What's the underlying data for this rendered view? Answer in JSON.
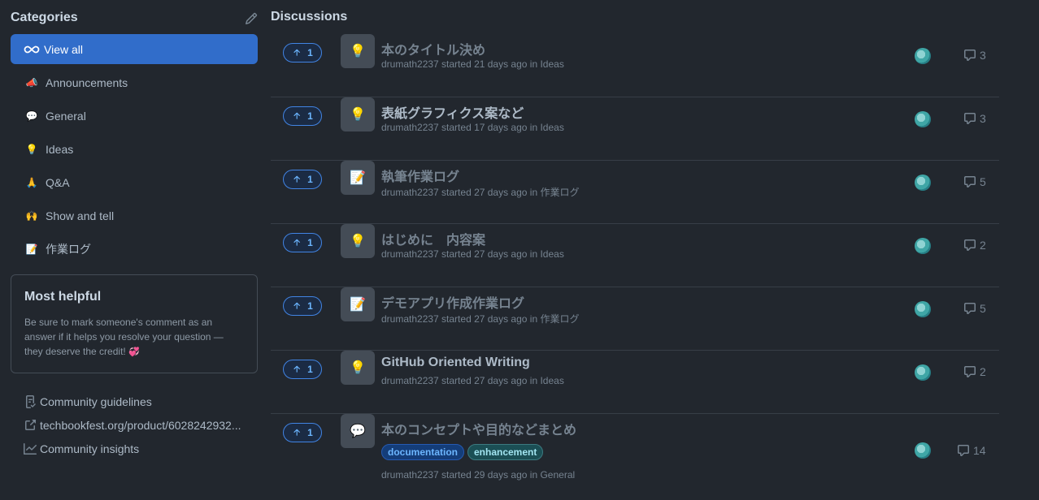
{
  "sidebar": {
    "title": "Categories",
    "categories": [
      {
        "label": "View all",
        "icon": "infinity-icon",
        "emoji": "∞",
        "active": true
      },
      {
        "label": "Announcements",
        "icon": "megaphone-icon",
        "emoji": "📣"
      },
      {
        "label": "General",
        "icon": "speech-bubble-icon",
        "emoji": "💬"
      },
      {
        "label": "Ideas",
        "icon": "lightbulb-icon",
        "emoji": "💡"
      },
      {
        "label": "Q&A",
        "icon": "folded-hands-icon",
        "emoji": "🙏"
      },
      {
        "label": "Show and tell",
        "icon": "raised-hands-icon",
        "emoji": "🙌"
      },
      {
        "label": "作業ログ",
        "icon": "memo-icon",
        "emoji": "📝"
      }
    ],
    "helpful": {
      "title": "Most helpful",
      "body": "Be sure to mark someone's comment as an answer if it helps you resolve your question — they deserve the credit!",
      "heart": "💞"
    },
    "links": [
      {
        "label": "Community guidelines",
        "icon": "guidelines-icon"
      },
      {
        "label": "techbookfest.org/product/6028242932...",
        "icon": "external-link-icon"
      },
      {
        "label": "Community insights",
        "icon": "graph-icon"
      }
    ]
  },
  "main": {
    "title": "Discussions",
    "discussions": [
      {
        "votes": "1",
        "category_emoji": "💡",
        "title": "本のタイトル決め",
        "meta": "drumath2237 started 21 days ago in Ideas",
        "comments": "3",
        "bright": false
      },
      {
        "votes": "1",
        "category_emoji": "💡",
        "title": "表紙グラフィクス案など",
        "meta": "drumath2237 started 17 days ago in Ideas",
        "comments": "3",
        "bright": true
      },
      {
        "votes": "1",
        "category_emoji": "📝",
        "title": "執筆作業ログ",
        "meta": "drumath2237 started 27 days ago in 作業ログ",
        "comments": "5",
        "bright": false
      },
      {
        "votes": "1",
        "category_emoji": "💡",
        "title": "はじめに　内容案",
        "meta": "drumath2237 started 27 days ago in Ideas",
        "comments": "2",
        "bright": false
      },
      {
        "votes": "1",
        "category_emoji": "📝",
        "title": "デモアプリ作成作業ログ",
        "meta": "drumath2237 started 27 days ago in 作業ログ",
        "comments": "5",
        "bright": false
      },
      {
        "votes": "1",
        "category_emoji": "💡",
        "title": "GitHub Oriented Writing",
        "meta": "drumath2237 started 27 days ago in Ideas",
        "comments": "2",
        "bright": true
      },
      {
        "votes": "1",
        "category_emoji": "💬",
        "title": "本のコンセプトや目的などまとめ",
        "meta": "drumath2237 started 29 days ago in General",
        "comments": "14",
        "bright": false,
        "labels": [
          "documentation",
          "enhancement"
        ]
      }
    ]
  }
}
